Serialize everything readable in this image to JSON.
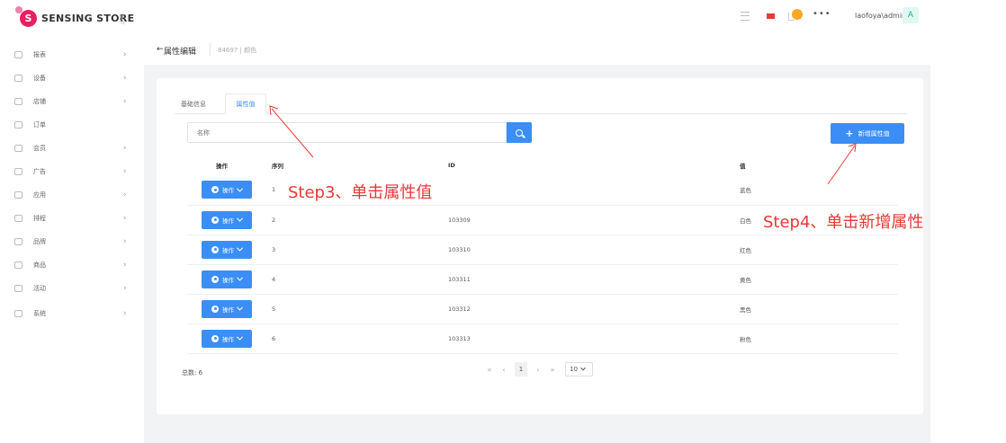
{
  "app": {
    "name": "SENSING STORE"
  },
  "sidebar": {
    "collapse_glyph": "《",
    "items": [
      {
        "label": "报表",
        "icon": "chart-icon",
        "has_arrow": true
      },
      {
        "label": "设备",
        "icon": "device-icon",
        "has_arrow": true
      },
      {
        "label": "店铺",
        "icon": "store-icon",
        "has_arrow": true
      },
      {
        "label": "订单",
        "icon": "order-icon",
        "has_arrow": false
      },
      {
        "label": "会员",
        "icon": "member-icon",
        "has_arrow": true
      },
      {
        "label": "广告",
        "icon": "ad-icon",
        "has_arrow": true
      },
      {
        "label": "应用",
        "icon": "app-icon",
        "has_arrow": true
      },
      {
        "label": "排程",
        "icon": "schedule-icon",
        "has_arrow": true
      },
      {
        "label": "品牌",
        "icon": "brand-icon",
        "has_arrow": true
      },
      {
        "label": "商品",
        "icon": "product-icon",
        "has_arrow": true
      },
      {
        "label": "活动",
        "icon": "campaign-icon",
        "has_arrow": true
      },
      {
        "label": "系统",
        "icon": "system-icon",
        "has_arrow": true
      }
    ]
  },
  "header": {
    "more_glyph": "•••",
    "user": "laofoya\\admin",
    "avatar_letter": "A"
  },
  "page": {
    "back_glyph": "←",
    "title": "属性编辑",
    "breadcrumb": "84697 | 颜色"
  },
  "tabs": [
    {
      "label": "基础信息",
      "active": false
    },
    {
      "label": "属性值",
      "active": true
    }
  ],
  "search": {
    "placeholder": "名称",
    "value": ""
  },
  "add_button": {
    "plus": "+",
    "label": "新增属性值"
  },
  "table": {
    "headers": {
      "op": "操作",
      "seq": "序列",
      "id": "ID",
      "value": "值"
    },
    "op_label": "操作",
    "rows": [
      {
        "seq": "1",
        "id": "",
        "value": "蓝色"
      },
      {
        "seq": "2",
        "id": "103309",
        "value": "白色"
      },
      {
        "seq": "3",
        "id": "103310",
        "value": "红色"
      },
      {
        "seq": "4",
        "id": "103311",
        "value": "黄色"
      },
      {
        "seq": "5",
        "id": "103312",
        "value": "黑色"
      },
      {
        "seq": "6",
        "id": "103313",
        "value": "粉色"
      }
    ]
  },
  "pagination": {
    "total_label": "总数: 6",
    "first": "«",
    "prev": "‹",
    "current": "1",
    "next": "›",
    "last": "»",
    "page_size": "10"
  },
  "annotations": {
    "step3": "Step3、单击属性值",
    "step4": "Step4、单击新增属性"
  },
  "colors": {
    "primary": "#3a8ef5",
    "annotation": "#e53935",
    "brand": "#e91e63"
  }
}
